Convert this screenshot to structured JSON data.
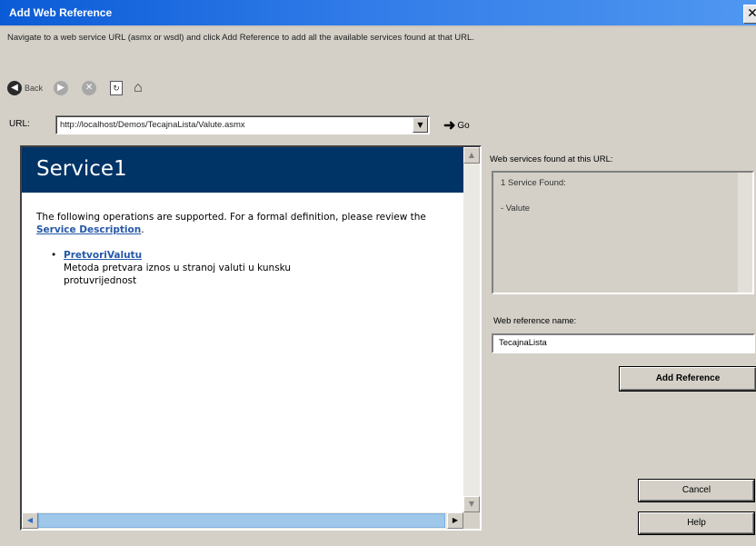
{
  "window": {
    "title": "Add Web Reference",
    "close_glyph": "✕"
  },
  "instructions": "Navigate to a web service URL (asmx or wsdl) and click Add Reference to add all the available services found at that URL.",
  "toolbar": {
    "back_label": "Back",
    "icons": [
      "back-icon",
      "forward-icon",
      "stop-icon",
      "refresh-icon",
      "home-icon"
    ]
  },
  "url": {
    "label": "URL:",
    "value": "http://localhost/Demos/TecajnaLista/Valute.asmx",
    "go_label": "Go"
  },
  "browser": {
    "service_name": "Service1",
    "intro_text": "The following operations are supported. For a formal definition, please review the ",
    "description_link": "Service Description",
    "intro_end": ".",
    "operations": [
      {
        "name": "PretvoriValutu",
        "description": "Metoda pretvara iznos u stranoj valuti u kunsku protuvrijednost"
      }
    ]
  },
  "services_found": {
    "label": "Web services found at this URL:",
    "count_text": "1 Service Found:",
    "items": [
      "- Valute"
    ]
  },
  "reference": {
    "label": "Web reference name:",
    "value": "TecajnaLista"
  },
  "buttons": {
    "add_reference": "Add Reference",
    "cancel": "Cancel",
    "help": "Help"
  },
  "colors": {
    "titlebar": "#0a5bd6",
    "service_header": "#003366",
    "link": "#2558a8",
    "dialog_bg": "#d4d0c8"
  }
}
